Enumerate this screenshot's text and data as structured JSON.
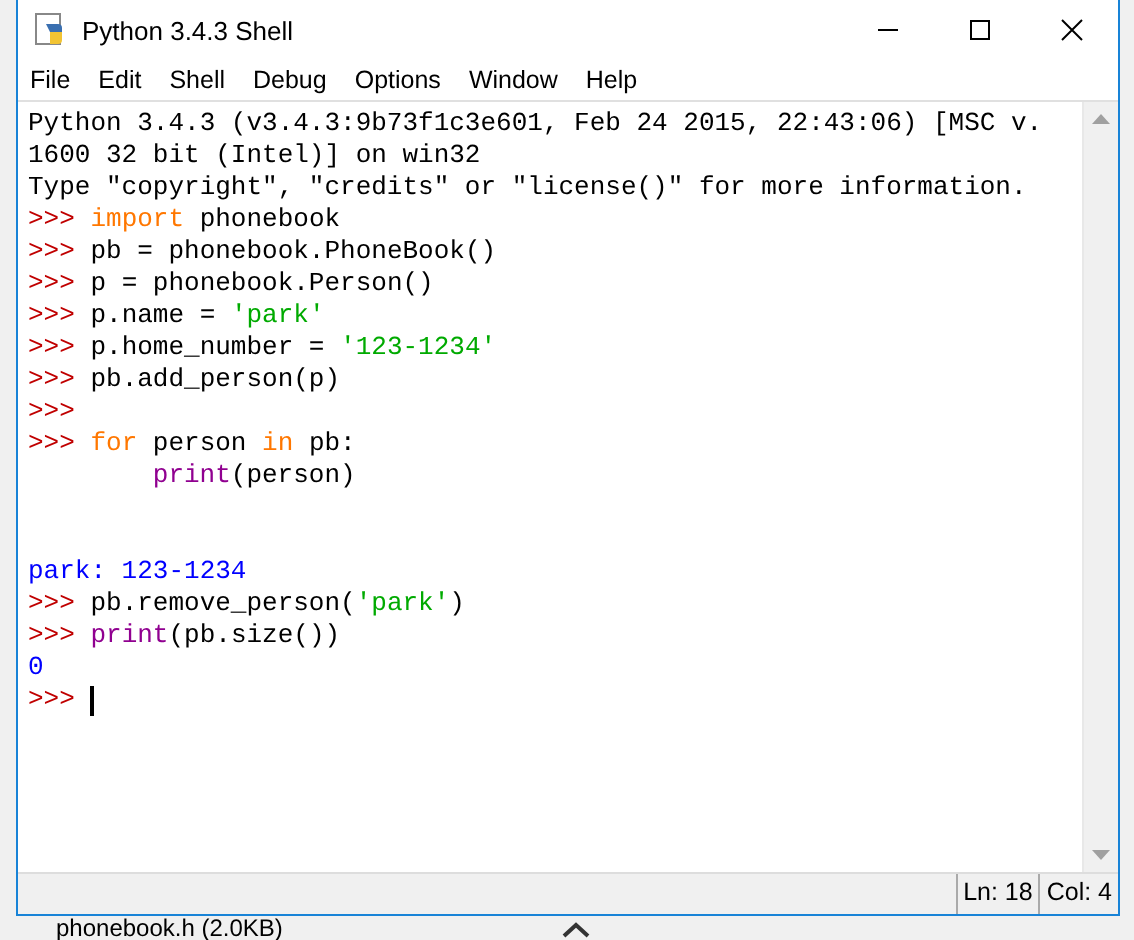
{
  "window": {
    "title": "Python 3.4.3 Shell"
  },
  "menu": [
    "File",
    "Edit",
    "Shell",
    "Debug",
    "Options",
    "Window",
    "Help"
  ],
  "lines": [
    {
      "kind": "text",
      "segments": [
        {
          "text": "Python 3.4.3 (v3.4.3:9b73f1c3e601, Feb 24 2015, 22:43:06) [MSC v.",
          "kind": "plain"
        }
      ]
    },
    {
      "kind": "text",
      "segments": [
        {
          "text": "1600 32 bit (Intel)] on win32",
          "kind": "plain"
        }
      ]
    },
    {
      "kind": "text",
      "segments": [
        {
          "text": "Type \"copyright\", \"credits\" or \"license()\" for more information.",
          "kind": "plain"
        }
      ]
    },
    {
      "kind": "text",
      "segments": [
        {
          "text": ">>> ",
          "kind": "prompt"
        },
        {
          "text": "import",
          "kind": "keyword"
        },
        {
          "text": " phonebook",
          "kind": "plain"
        }
      ]
    },
    {
      "kind": "text",
      "segments": [
        {
          "text": ">>> ",
          "kind": "prompt"
        },
        {
          "text": "pb = phonebook.PhoneBook()",
          "kind": "plain"
        }
      ]
    },
    {
      "kind": "text",
      "segments": [
        {
          "text": ">>> ",
          "kind": "prompt"
        },
        {
          "text": "p = phonebook.Person()",
          "kind": "plain"
        }
      ]
    },
    {
      "kind": "text",
      "segments": [
        {
          "text": ">>> ",
          "kind": "prompt"
        },
        {
          "text": "p.name = ",
          "kind": "plain"
        },
        {
          "text": "'park'",
          "kind": "string"
        }
      ]
    },
    {
      "kind": "text",
      "segments": [
        {
          "text": ">>> ",
          "kind": "prompt"
        },
        {
          "text": "p.home_number = ",
          "kind": "plain"
        },
        {
          "text": "'123-1234'",
          "kind": "string"
        }
      ]
    },
    {
      "kind": "text",
      "segments": [
        {
          "text": ">>> ",
          "kind": "prompt"
        },
        {
          "text": "pb.add_person(p)",
          "kind": "plain"
        }
      ]
    },
    {
      "kind": "text",
      "segments": [
        {
          "text": ">>>",
          "kind": "prompt"
        }
      ]
    },
    {
      "kind": "text",
      "segments": [
        {
          "text": ">>> ",
          "kind": "prompt"
        },
        {
          "text": "for",
          "kind": "keyword"
        },
        {
          "text": " person ",
          "kind": "plain"
        },
        {
          "text": "in",
          "kind": "keyword"
        },
        {
          "text": " pb:",
          "kind": "plain"
        }
      ]
    },
    {
      "kind": "text",
      "indent": true,
      "segments": [
        {
          "text": "print",
          "kind": "builtin"
        },
        {
          "text": "(person)",
          "kind": "plain"
        }
      ]
    },
    {
      "kind": "blank"
    },
    {
      "kind": "blank"
    },
    {
      "kind": "text",
      "segments": [
        {
          "text": "park: 123-1234",
          "kind": "output"
        }
      ]
    },
    {
      "kind": "text",
      "segments": [
        {
          "text": ">>> ",
          "kind": "prompt"
        },
        {
          "text": "pb.remove_person(",
          "kind": "plain"
        },
        {
          "text": "'park'",
          "kind": "string"
        },
        {
          "text": ")",
          "kind": "plain"
        }
      ]
    },
    {
      "kind": "text",
      "segments": [
        {
          "text": ">>> ",
          "kind": "prompt"
        },
        {
          "text": "print",
          "kind": "builtin"
        },
        {
          "text": "(pb.size())",
          "kind": "plain"
        }
      ]
    },
    {
      "kind": "text",
      "segments": [
        {
          "text": "0",
          "kind": "output"
        }
      ]
    },
    {
      "kind": "input",
      "segments": [
        {
          "text": ">>> ",
          "kind": "prompt"
        }
      ]
    }
  ],
  "status_bar": {
    "line": "Ln: 18",
    "column": "Col: 4"
  },
  "background": {
    "file_label": "phonebook.h (2.0KB)"
  }
}
